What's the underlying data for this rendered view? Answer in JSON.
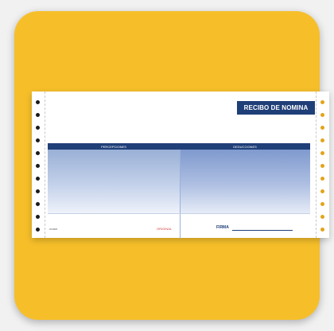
{
  "receipt": {
    "title": "RECIBO DE NOMINA",
    "col_left": "PERCEPCIONES",
    "col_right": "DEDUCCIONES",
    "code": "201808",
    "original": "ORIGINAL",
    "firma": "FIRMA"
  },
  "colors": {
    "tile": "#f6bf2a",
    "navy": "#1f3f78",
    "red": "#d23a3a",
    "panel_blue": "#9ab0d6"
  },
  "icons": {
    "left_feed_holes": "black-dot-icon",
    "right_feed_holes": "orange-dot-icon"
  }
}
